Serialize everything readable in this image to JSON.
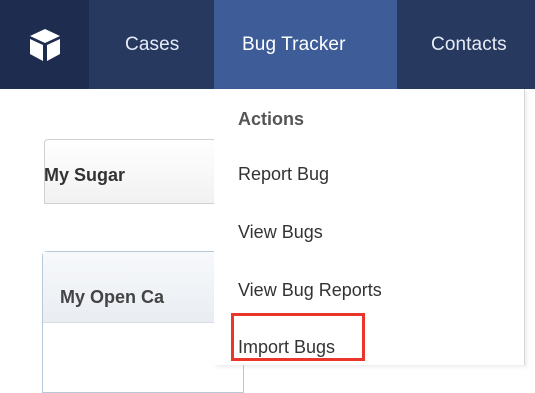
{
  "navbar": {
    "items": [
      "Cases",
      "Bug Tracker",
      "Contacts"
    ]
  },
  "dropdown": {
    "header": "Actions",
    "items": [
      "Report Bug",
      "View Bugs",
      "View Bug Reports",
      "Import Bugs"
    ],
    "highlighted_item": "Import Bugs"
  },
  "content": {
    "tab_label": "My Sugar",
    "dashlet_title": "My Open Ca"
  },
  "colors": {
    "navbar_bg": "#283960",
    "active_tab_bg": "#3d5c98",
    "highlight": "#e8362b"
  },
  "icons": {
    "logo": "cube-icon"
  }
}
